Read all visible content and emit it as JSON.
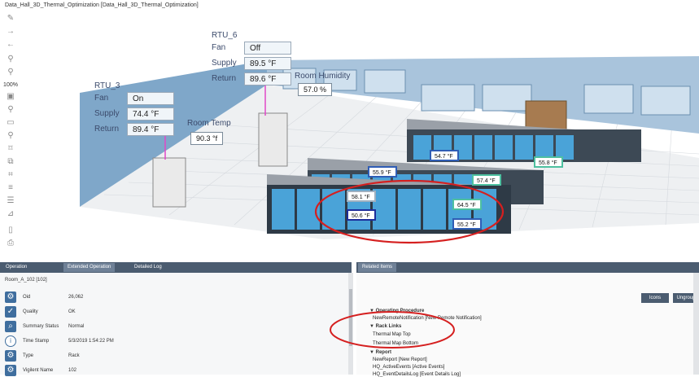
{
  "window": {
    "title": "Data_Hall_3D_Thermal_Optimization [Data_Hall_3D_Thermal_Optimization]"
  },
  "toolbar": {
    "zoom_label": "100%"
  },
  "scene": {
    "rtu6": {
      "name": "RTU_6",
      "fan_label": "Fan",
      "fan_value": "Off",
      "supply_label": "Supply",
      "supply_value": "89.5 °F",
      "return_label": "Return",
      "return_value": "89.6 °F"
    },
    "rtu3": {
      "name": "RTU_3",
      "fan_label": "Fan",
      "fan_value": "On",
      "supply_label": "Supply",
      "supply_value": "74.4 °F",
      "return_label": "Return",
      "return_value": "89.4 °F"
    },
    "room_humidity": {
      "label": "Room Humidity",
      "value": "57.0 %"
    },
    "room_temp": {
      "label": "Room Temp",
      "value": "90.3 °f"
    },
    "rack_temps": [
      "54.7 °F",
      "55.8 °F",
      "55.9 °F",
      "57.4 °F",
      "58.1 °F",
      "64.5 °F",
      "50.6 °F",
      "55.2 °F"
    ]
  },
  "tabs": {
    "operation": "Operation",
    "extended": "Extended Operation",
    "detail_log": "Detailed Log",
    "related": "Related Items"
  },
  "properties": {
    "header": "Room_A_102 [102]",
    "rows": [
      {
        "label": "Oid",
        "value": "26,062"
      },
      {
        "label": "Quality",
        "value": "OK"
      },
      {
        "label": "Summary Status",
        "value": "Normal"
      },
      {
        "label": "Time Stamp",
        "value": "5/3/2019 1:54:22 PM"
      },
      {
        "label": "Type",
        "value": "Rack"
      },
      {
        "label": "Vigilent Name",
        "value": "102"
      }
    ]
  },
  "related": {
    "icons_button": "Icons",
    "ungroup_button": "Ungroup",
    "sections": [
      {
        "title": "Operating Procedure",
        "items": [
          "NewRemoteNotification [New Remote Notification]"
        ]
      },
      {
        "title": "Rack Links",
        "items": [
          "Thermal Map Top",
          "Thermal Map Bottom"
        ]
      },
      {
        "title": "Report",
        "items": [
          "NewReport [New Report]",
          "HQ_ActiveEvents [Active Events]",
          "HQ_EventDetailsLog [Event Details Log]"
        ]
      }
    ]
  },
  "colors": {
    "accent": "#4b5c70",
    "highlight_circle": "#d51f1f",
    "wall": "#7fa7c9",
    "floor": "#eef0f2"
  }
}
